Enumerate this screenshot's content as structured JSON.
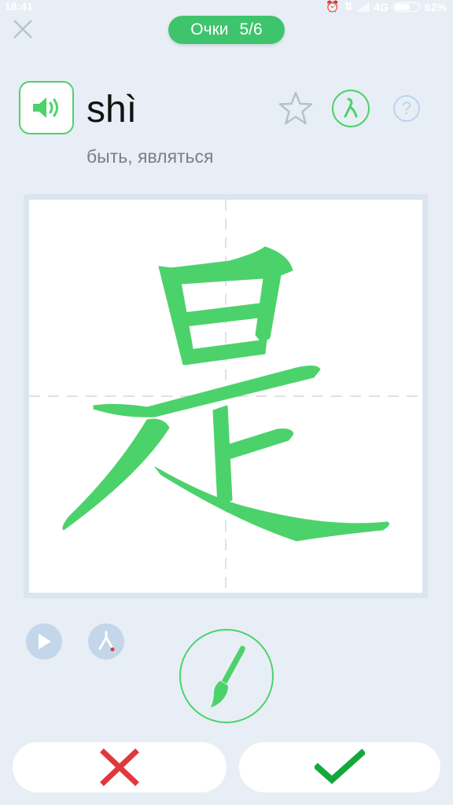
{
  "status_bar": {
    "time": "18:41",
    "network": "4G",
    "battery": "62%",
    "battery_level": 0.62
  },
  "header": {
    "close_icon": "close-icon",
    "score_label": "Очки",
    "score_value": "5/6"
  },
  "word": {
    "pinyin": "shì",
    "meaning": "быть, являться",
    "character": "是",
    "sound_icon": "speaker-icon",
    "favorite_icon": "star-outline-icon",
    "stroke_order_icon": "stroke-order-icon",
    "help_icon": "help-icon",
    "help_glyph": "?"
  },
  "board": {
    "grid": "dashed cross guides",
    "character_color": "#4cd26b"
  },
  "controls": {
    "play_icon": "play-icon",
    "hint_icon": "stroke-hint-icon",
    "brush_icon": "brush-icon"
  },
  "answers": {
    "wrong_icon": "red-cross-icon",
    "right_icon": "green-check-icon"
  },
  "colors": {
    "accent": "#4cd26b",
    "score_pill": "#3ec46d",
    "background": "#e8eef5",
    "wrong": "#e0383c",
    "muted_blue": "#c4d6ea"
  }
}
